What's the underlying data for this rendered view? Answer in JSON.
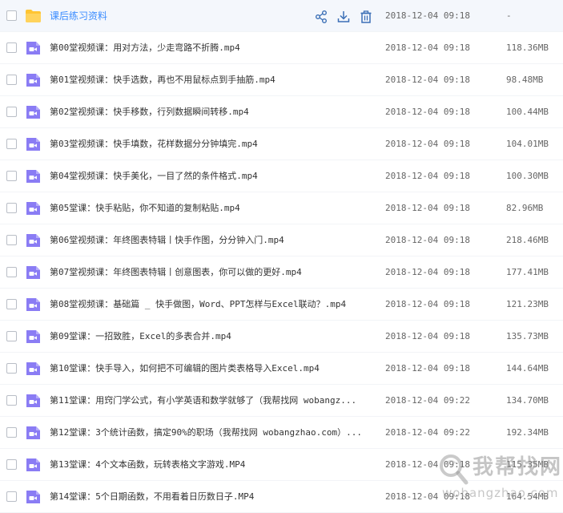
{
  "colors": {
    "accent": "#3b8cff",
    "folder": "#ffc533",
    "video_icon": "#8a7cf4",
    "row_highlight": "#f4f7fc"
  },
  "folder_row": {
    "name": "课后练习资料",
    "date": "2018-12-04 09:18",
    "size": "-",
    "icon": "folder-icon",
    "actions": [
      "share-icon",
      "download-icon",
      "delete-icon"
    ]
  },
  "files": [
    {
      "name": "第00堂视频课：用对方法，少走弯路不折腾.mp4",
      "date": "2018-12-04 09:18",
      "size": "118.36MB",
      "icon": "video-file-icon"
    },
    {
      "name": "第01堂视频课：快手选数，再也不用鼠标点到手抽筋.mp4",
      "date": "2018-12-04 09:18",
      "size": "98.48MB",
      "icon": "video-file-icon"
    },
    {
      "name": "第02堂视频课：快手移数，行列数据瞬间转移.mp4",
      "date": "2018-12-04 09:18",
      "size": "100.44MB",
      "icon": "video-file-icon"
    },
    {
      "name": "第03堂视频课：快手填数，花样数据分分钟填完.mp4",
      "date": "2018-12-04 09:18",
      "size": "104.01MB",
      "icon": "video-file-icon"
    },
    {
      "name": "第04堂视频课：快手美化，一目了然的条件格式.mp4",
      "date": "2018-12-04 09:18",
      "size": "100.30MB",
      "icon": "video-file-icon"
    },
    {
      "name": "第05堂课：快手粘贴，你不知道的复制粘贴.mp4",
      "date": "2018-12-04 09:18",
      "size": "82.96MB",
      "icon": "video-file-icon"
    },
    {
      "name": "第06堂视频课：年终图表特辑丨快手作图，分分钟入门.mp4",
      "date": "2018-12-04 09:18",
      "size": "218.46MB",
      "icon": "video-file-icon"
    },
    {
      "name": "第07堂视频课：年终图表特辑丨创意图表，你可以做的更好.mp4",
      "date": "2018-12-04 09:18",
      "size": "177.41MB",
      "icon": "video-file-icon"
    },
    {
      "name": "第08堂视频课：基础篇 _ 快手做图，Word、PPT怎样与Excel联动？.mp4",
      "date": "2018-12-04 09:18",
      "size": "121.23MB",
      "icon": "video-file-icon"
    },
    {
      "name": "第09堂课：一招致胜，Excel的多表合并.mp4",
      "date": "2018-12-04 09:18",
      "size": "135.73MB",
      "icon": "video-file-icon"
    },
    {
      "name": "第10堂课：快手导入，如何把不可编辑的图片类表格导入Excel.mp4",
      "date": "2018-12-04 09:18",
      "size": "144.64MB",
      "icon": "video-file-icon"
    },
    {
      "name": "第11堂课：用窍门学公式，有小学英语和数学就够了（我帮找网 wobangz...",
      "date": "2018-12-04 09:22",
      "size": "134.70MB",
      "icon": "video-file-icon"
    },
    {
      "name": "第12堂课：3个统计函数，搞定90%的职场（我帮找网 wobangzhao.com）...",
      "date": "2018-12-04 09:22",
      "size": "192.34MB",
      "icon": "video-file-icon"
    },
    {
      "name": "第13堂课：4个文本函数，玩转表格文字游戏.MP4",
      "date": "2018-12-04 09:18",
      "size": "115.35MB",
      "icon": "video-file-icon"
    },
    {
      "name": "第14堂课：5个日期函数，不用看着日历数日子.MP4",
      "date": "2018-12-04 09:18",
      "size": "164.54MB",
      "icon": "video-file-icon"
    }
  ],
  "watermark": {
    "title": "我帮找网",
    "url": "wobangzhao.com"
  }
}
